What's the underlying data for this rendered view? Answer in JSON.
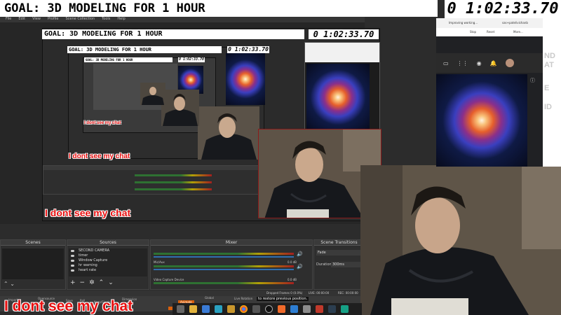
{
  "overlay": {
    "goal": "GOAL: 3D MODELING FOR 1 HOUR",
    "timer": "0 1:02:33.70",
    "chat_caption": "I dont see my chat"
  },
  "obs": {
    "menu": [
      "File",
      "Edit",
      "View",
      "Profile",
      "Scene Collection",
      "Tools",
      "Help"
    ],
    "docks": {
      "scenes": "Scenes",
      "sources": "Sources",
      "mixer": "Mixer",
      "transitions": "Scene Transitions"
    },
    "sources": [
      "SECOND CAMERA",
      "timer",
      "Window Capture",
      "hr warning",
      "heart rate"
    ],
    "mixer": {
      "channels": [
        "Mic/Aux",
        "Video Capture Device"
      ],
      "levels": [
        "0.0 dB",
        "0.0 dB"
      ]
    },
    "transitions": {
      "type": "Fade",
      "duration_label": "Duration",
      "duration_value": "300ms"
    },
    "status": {
      "dropped": "Dropped Frames 0 (0.0%)",
      "live": "LIVE: 00:00:00",
      "rec": "REC: 00:00:00"
    },
    "bottom_labels": [
      "Import",
      "Groups",
      "Opensource",
      "Save",
      "Roll",
      "Keep/Single",
      "Dimension",
      "Update",
      "Keep/Single",
      "Animate",
      "Global",
      "Live Rotation",
      "Rotate"
    ],
    "tooltip": "to restore previous position."
  },
  "browser": {
    "toolbar": [
      "Improving working...",
      "Stop",
      "Reset",
      "More...",
      "sas+patelivichanb"
    ],
    "side_letters": [
      "ND",
      "AT",
      "E",
      "ID"
    ]
  },
  "taskbar": {
    "icons": [
      "task-view",
      "file-explorer",
      "mail",
      "edge",
      "folder",
      "chrome",
      "calculator",
      "obs",
      "paint",
      "app",
      "app",
      "app",
      "app",
      "app"
    ]
  },
  "colors": {
    "accent_red": "#e81010",
    "obs_bg": "#2c2c2c",
    "dock_bg": "#2e2e2e",
    "highlight_orange": "#d9600c",
    "browser_bg": "#202124"
  }
}
